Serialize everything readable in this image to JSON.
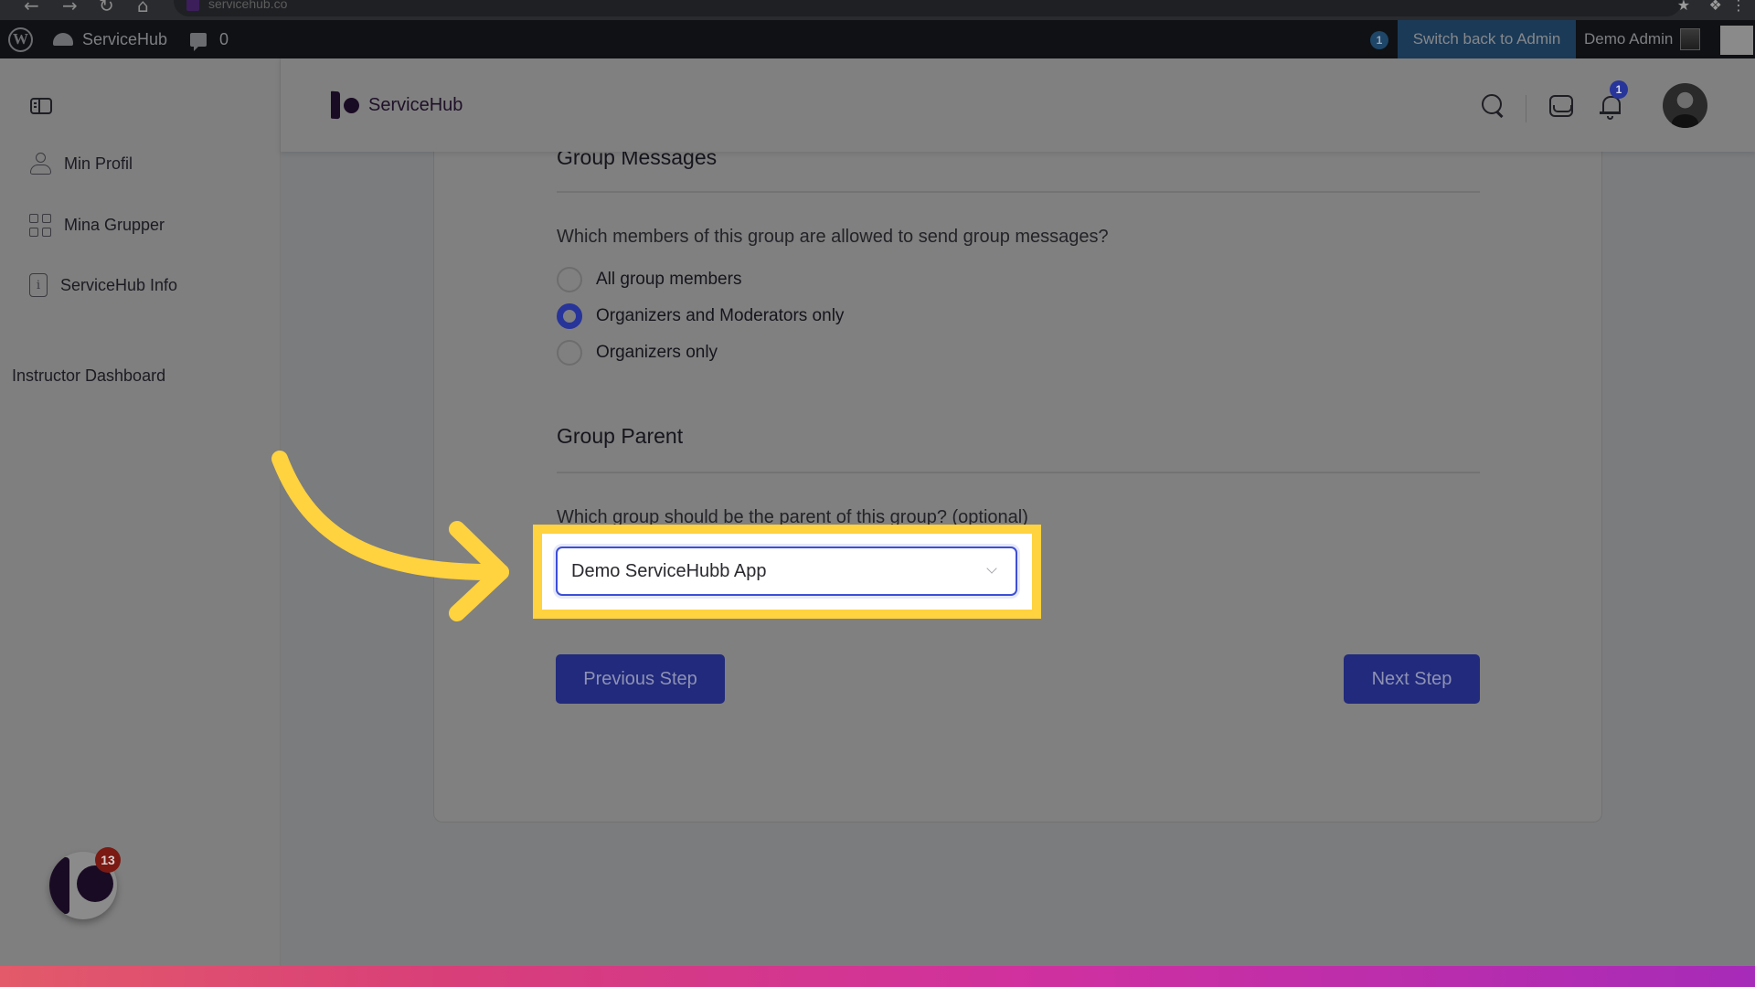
{
  "browser": {
    "url": "servicehub.co",
    "nav_icons": [
      "back-arrow",
      "forward-arrow",
      "reload",
      "home"
    ]
  },
  "wp_admin_bar": {
    "logo": "wordpress-icon",
    "site_name": "ServiceHub",
    "comments_count": "0",
    "notification_count": "1",
    "switch_label": "Switch back to Admin",
    "user_name": "Demo Admin"
  },
  "sidebar": {
    "items": [
      {
        "label": "Min Profil",
        "icon": "user-icon"
      },
      {
        "label": "Mina Grupper",
        "icon": "grid-icon"
      },
      {
        "label": "ServiceHub Info",
        "icon": "info-icon"
      }
    ],
    "instructor_link": "Instructor Dashboard",
    "chat_badge_count": "13"
  },
  "header": {
    "brand": "ServiceHub",
    "notifications_count": "1"
  },
  "form": {
    "group_messages": {
      "title": "Group Messages",
      "question": "Which members of this group are allowed to send group messages?",
      "options": [
        {
          "label": "All group members",
          "checked": false
        },
        {
          "label": "Organizers and Moderators only",
          "checked": true
        },
        {
          "label": "Organizers only",
          "checked": false
        }
      ]
    },
    "group_parent": {
      "title": "Group Parent",
      "question": "Which group should be the parent of this group? (optional)",
      "selected_value": "Demo ServiceHubb App"
    },
    "previous_label": "Previous Step",
    "next_label": "Next Step"
  },
  "colors": {
    "primary": "#27349a",
    "highlight": "#ffd23f",
    "admin_switch": "#1b3a57"
  }
}
